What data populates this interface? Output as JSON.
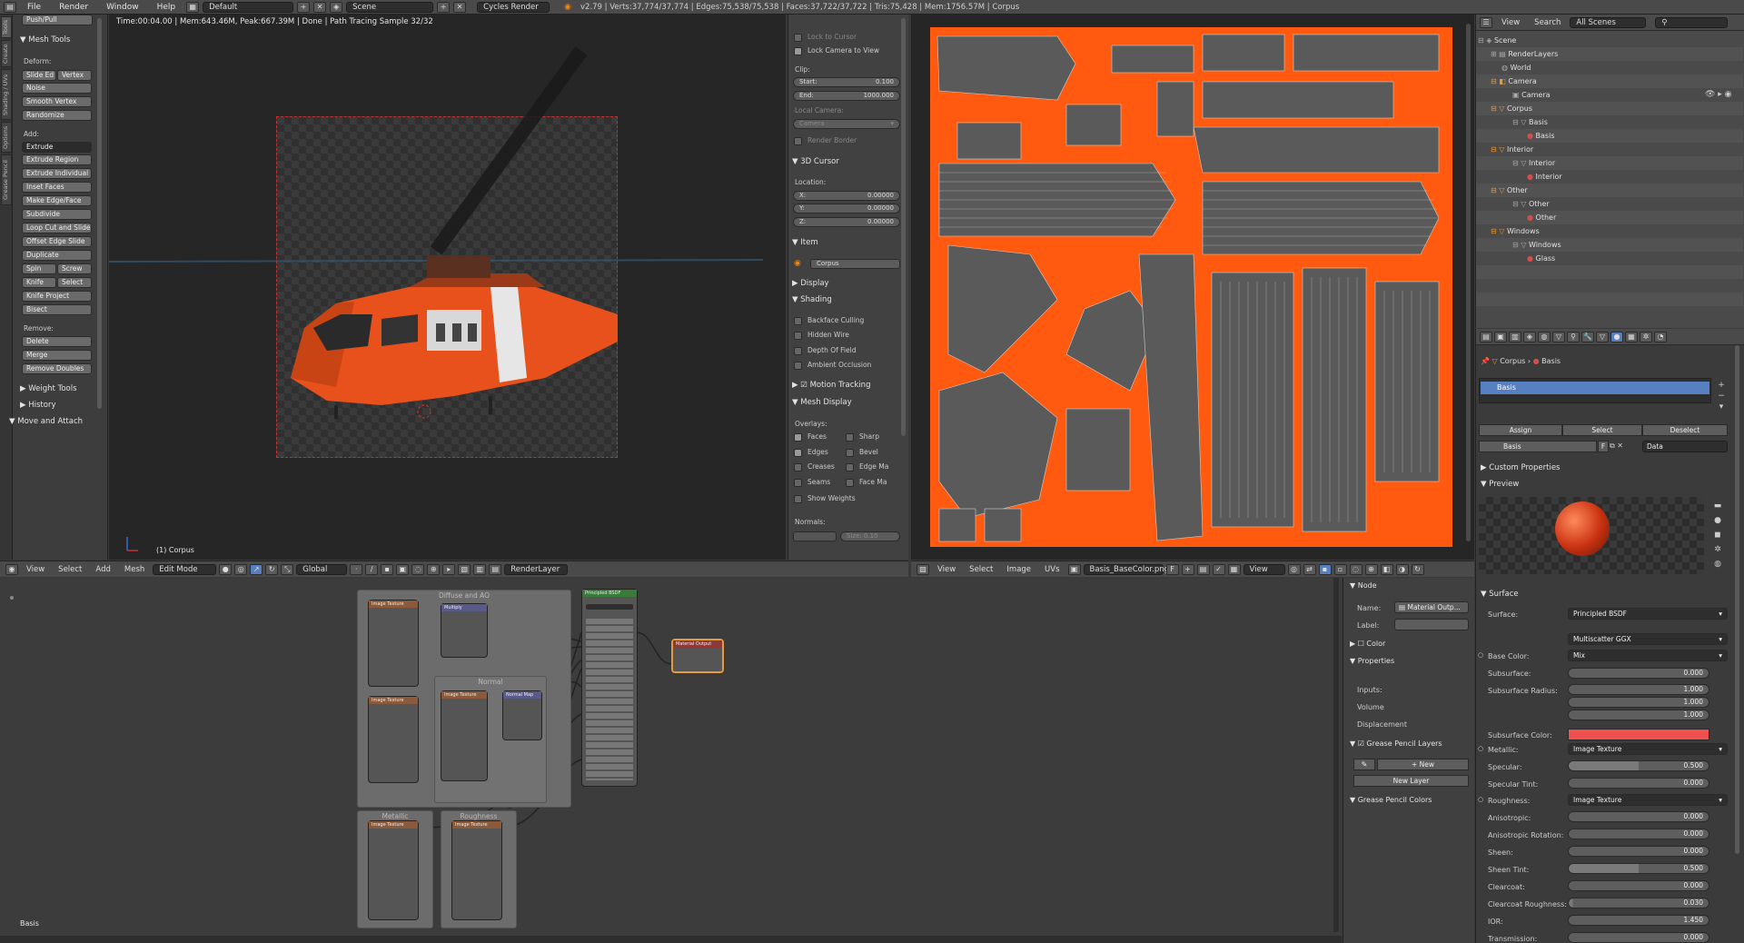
{
  "topbar": {
    "menus": [
      "File",
      "Render",
      "Window",
      "Help"
    ],
    "screen": "Default",
    "scene": "Scene",
    "engine": "Cycles Render",
    "stats": "v2.79 | Verts:37,774/37,774 | Edges:75,538/75,538 | Faces:37,722/37,722 | Tris:75,428 | Mem:1756.57M | Corpus"
  },
  "toolshelf": {
    "tabs": [
      "Tools",
      "Create",
      "Shading / UVs",
      "Options",
      "Grease Pencil"
    ],
    "top_button": "Push/Pull",
    "mesh_tools": "Mesh Tools",
    "deform_label": "Deform:",
    "deform": [
      "Slide Ed",
      "Vertex",
      "Noise",
      "Smooth Vertex",
      "Randomize"
    ],
    "add_label": "Add:",
    "add": [
      "Extrude",
      "Extrude Region",
      "Extrude Individual",
      "Inset Faces",
      "Make Edge/Face",
      "Subdivide",
      "Loop Cut and Slide",
      "Offset Edge Slide",
      "Duplicate",
      "Spin",
      "Screw",
      "Knife",
      "Select",
      "Knife Project",
      "Bisect"
    ],
    "remove_label": "Remove:",
    "remove": [
      "Delete",
      "Merge",
      "Remove Doubles"
    ],
    "sections": [
      "Weight Tools",
      "History",
      "Move and Attach"
    ]
  },
  "viewport": {
    "status": "Time:00:04.00 | Mem:643.46M, Peak:667.39M | Done | Path Tracing Sample 32/32",
    "object_label": "(1) Corpus"
  },
  "props3d": {
    "lock_cursor": "Lock to Cursor",
    "lock_camera": "Lock Camera to View",
    "clip": "Clip:",
    "start_label": "Start:",
    "start_value": "0.100",
    "end_label": "End:",
    "end_value": "1000.000",
    "local_camera": "Local Camera:",
    "camera": "Camera",
    "render_border": "Render Border",
    "cursor_head": "3D Cursor",
    "location": "Location:",
    "x_label": "X:",
    "x_value": "0.00000",
    "y_label": "Y:",
    "y_value": "0.00000",
    "z_label": "Z:",
    "z_value": "0.00000",
    "item_head": "Item",
    "item_name": "Corpus",
    "display_head": "Display",
    "shading_head": "Shading",
    "shading_opts": [
      "Backface Culling",
      "Hidden Wire",
      "Depth Of Field",
      "Ambient Occlusion"
    ],
    "motion_tracking": "Motion Tracking",
    "mesh_display": "Mesh Display",
    "overlays": "Overlays:",
    "overlay_left": [
      "Faces",
      "Edges",
      "Creases",
      "Seams",
      "Show Weights"
    ],
    "overlay_right": [
      "Sharp",
      "Bevel",
      "Edge Ma",
      "Face Ma"
    ],
    "normals": "Normals:",
    "size": "Size: 0.10"
  },
  "vp3d_header": {
    "menus": [
      "View",
      "Select",
      "Add",
      "Mesh"
    ],
    "mode": "Edit Mode",
    "orientation": "Global",
    "render_layer": "RenderLayer"
  },
  "uv_header": {
    "menus": [
      "View",
      "Select",
      "Image",
      "UVs"
    ],
    "image": "Basis_BaseColor.png",
    "view": "View"
  },
  "outliner": {
    "menus": [
      "View",
      "Search"
    ],
    "filter": "All Scenes",
    "rows": [
      "Scene",
      "RenderLayers",
      "World",
      "Camera",
      "Camera",
      "Corpus",
      "Basis",
      "Basis",
      "Interior",
      "Interior",
      "Interior",
      "Other",
      "Other",
      "Other",
      "Windows",
      "Windows",
      "Glass"
    ]
  },
  "material": {
    "breadcrumb_obj": "Corpus",
    "breadcrumb_mat": "Basis",
    "slot": "Basis",
    "assign": "Assign",
    "select": "Select",
    "deselect": "Deselect",
    "mat_name": "Basis",
    "f_flag": "F",
    "data": "Data",
    "custom_props": "Custom Properties",
    "preview": "Preview",
    "surface_head": "Surface",
    "surface_label": "Surface:",
    "surface_value": "Principled BSDF",
    "distribution": "Multiscatter GGX",
    "base_color_label": "Base Color:",
    "base_color_value": "Mix",
    "subsurface_label": "Subsurface:",
    "subsurface_value": "0.000",
    "radius_label": "Subsurface Radius:",
    "radius": [
      "1.000",
      "1.000",
      "1.000"
    ],
    "ss_color_label": "Subsurface Color:",
    "ss_color": "#f05050",
    "metallic_label": "Metallic:",
    "metallic_value": "Image Texture",
    "specular_label": "Specular:",
    "specular_value": "0.500",
    "spec_tint_label": "Specular Tint:",
    "spec_tint_value": "0.000",
    "roughness_label": "Roughness:",
    "roughness_value": "Image Texture",
    "aniso_label": "Anisotropic:",
    "aniso_value": "0.000",
    "aniso_rot_label": "Anisotropic Rotation:",
    "aniso_rot_value": "0.000",
    "sheen_label": "Sheen:",
    "sheen_value": "0.000",
    "sheen_tint_label": "Sheen Tint:",
    "sheen_tint_value": "0.500",
    "clearcoat_label": "Clearcoat:",
    "clearcoat_value": "0.000",
    "cc_rough_label": "Clearcoat Roughness:",
    "cc_rough_value": "0.030",
    "ior_label": "IOR:",
    "ior_value": "1.450",
    "transmission_label": "Transmission:",
    "transmission_value": "0.000"
  },
  "node_editor": {
    "material_label": "Basis",
    "frames": [
      "Diffuse and AO",
      "Normal",
      "Metallic",
      "Roughness"
    ],
    "principled": "Principled BSDF",
    "output": "Material Output",
    "image_texture": "Image Texture",
    "multiply": "Multiply",
    "normal_map": "Normal Map"
  },
  "node_sidebar": {
    "node_head": "Node",
    "name_label": "Name:",
    "name_value": "Material Outp...",
    "label_label": "Label:",
    "color_head": "Color",
    "properties_head": "Properties",
    "inputs": "Inputs:",
    "volume": "Volume",
    "displacement": "Displacement",
    "gp_layers": "Grease Pencil Layers",
    "new": "New",
    "new_layer": "New Layer",
    "gp_colors": "Grease Pencil Colors"
  },
  "colors": {
    "accent": "#5680c2",
    "heli_orange": "#e8501c",
    "uv_orange": "#ff5a0f",
    "active_btn": "#2b2b2b"
  }
}
